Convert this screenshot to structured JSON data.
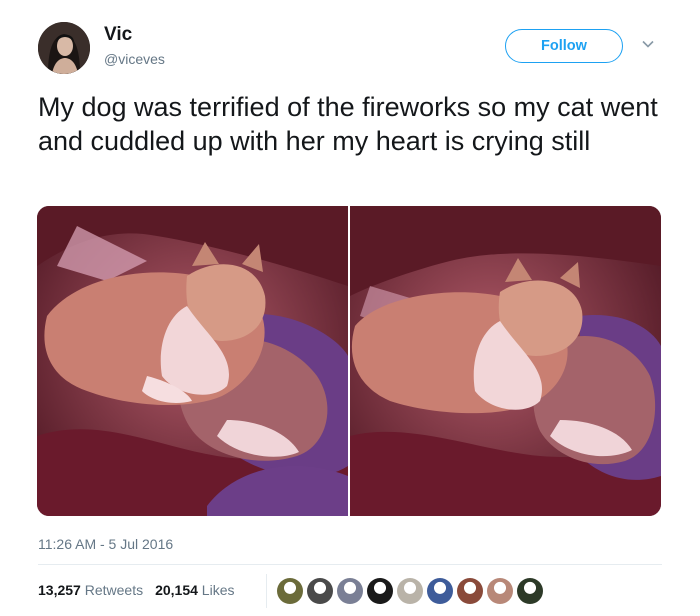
{
  "user": {
    "name": "Vic",
    "handle": "@viceves"
  },
  "follow_label": "Follow",
  "tweet_text": "My dog was terrified of the fireworks so my cat went and cuddled up with her my heart is crying still",
  "timestamp": "11:26 AM - 5 Jul 2016",
  "stats": {
    "retweets_count": "13,257",
    "retweets_label": "Retweets",
    "likes_count": "20,154",
    "likes_label": "Likes"
  },
  "colors": {
    "accent": "#1da1f2",
    "muted": "#657786",
    "text": "#14171a"
  },
  "likers": [
    {
      "color": "#6b6b3a"
    },
    {
      "color": "#4a4a4a"
    },
    {
      "color": "#7a7f95"
    },
    {
      "color": "#1a1a1a"
    },
    {
      "color": "#b9b3a8"
    },
    {
      "color": "#3e5c9a"
    },
    {
      "color": "#8a4a3a"
    },
    {
      "color": "#b88878"
    },
    {
      "color": "#2d3a28"
    }
  ]
}
